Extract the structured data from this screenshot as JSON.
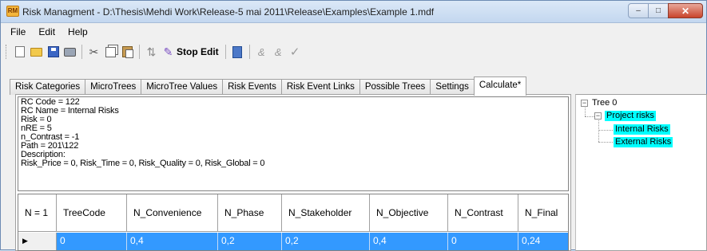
{
  "window": {
    "title": "Risk Managment - D:\\Thesis\\Mehdi Work\\Release-5 mai 2011\\Release\\Examples\\Example 1.mdf",
    "app_icon_text": "RM",
    "controls": {
      "minimize": "–",
      "maximize": "□",
      "close": "✕"
    }
  },
  "menu": [
    "File",
    "Edit",
    "Help"
  ],
  "toolbar": {
    "stop_edit_label": "Stop Edit",
    "icons": [
      "new-icon",
      "open-icon",
      "save-icon",
      "print-icon",
      "cut-icon",
      "copy-icon",
      "paste-icon",
      "refresh-icon",
      "wand-icon",
      "calculator-icon",
      "disabled-edit-icon",
      "disabled-edit2-icon",
      "check-icon"
    ]
  },
  "tabs": [
    {
      "label": "Risk Categories"
    },
    {
      "label": "MicroTrees"
    },
    {
      "label": "MicroTree Values"
    },
    {
      "label": "Risk Events"
    },
    {
      "label": "Risk Event Links"
    },
    {
      "label": "Possible Trees"
    },
    {
      "label": "Settings"
    },
    {
      "label": "Calculate*",
      "active": true
    }
  ],
  "info_lines": [
    "RC Code = 122",
    "RC Name = Internal Risks",
    "Risk = 0",
    "nRE = 5",
    "n_Contrast = -1",
    "Path = 201\\122",
    "Description:",
    "Risk_Price = 0, Risk_Time = 0, Risk_Quality = 0, Risk_Global = 0"
  ],
  "grid": {
    "columns": [
      "N = 1",
      "TreeCode",
      "N_Convenience",
      "N_Phase",
      "N_Stakeholder",
      "N_Objective",
      "N_Contrast",
      "N_Final"
    ],
    "rows": [
      {
        "marker": "▶",
        "cells": [
          "0",
          "0,4",
          "0,2",
          "0,2",
          "0,4",
          "0",
          "0,24"
        ]
      }
    ],
    "selection_color": "#3399ff"
  },
  "tree": {
    "root": "Tree 0",
    "child": "Project risks",
    "leaves": [
      "Internal Risks",
      "External Risks"
    ],
    "highlight_color": "#00ffff"
  }
}
